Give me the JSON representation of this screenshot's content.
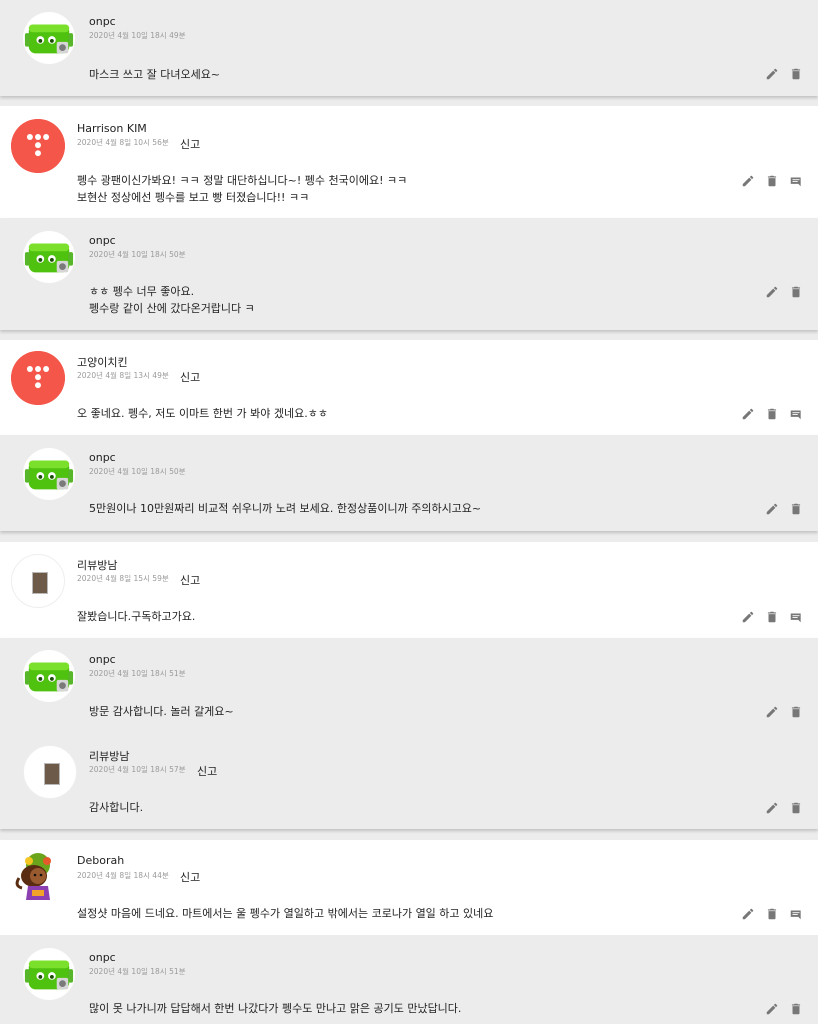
{
  "colors": {
    "accent_red": "#f4574a",
    "onpc_green": "#55c411",
    "reply_bg": "#ececec",
    "comment_bg": "#ffffff",
    "icon": "#777777"
  },
  "icons": {
    "edit": "pencil-icon",
    "delete": "trash-icon",
    "reply": "comment-icon"
  },
  "report_label": "신고",
  "threads": [
    {
      "replies": [
        {
          "author": "onpc",
          "date": "2020년 4월 10일 18시 49분",
          "lines": [
            "마스크 쓰고 잘 다녀오세요~"
          ]
        }
      ]
    },
    {
      "comment": {
        "author": "Harrison KIM",
        "date": "2020년 4월 8일 10시 56분",
        "lines": [
          "펭수 광팬이신가봐요! ㅋㅋ 정말 대단하십니다~! 펭수 천국이에요! ㅋㅋ",
          "보현산 정상에선 펭수를 보고 빵 터졌습니다!! ㅋㅋ"
        ]
      },
      "replies": [
        {
          "author": "onpc",
          "date": "2020년 4월 10일 18시 50분",
          "lines": [
            "ㅎㅎ 펭수 너무 좋아요.",
            "펭수랑 같이 산에 갔다온거랍니다 ㅋ"
          ]
        }
      ]
    },
    {
      "comment": {
        "author": "고양이치킨",
        "date": "2020년 4월 8일 13시 49분",
        "lines": [
          "오 좋네요. 펭수, 저도 이마트 한번 가 봐야 겠네요.ㅎㅎ"
        ]
      },
      "replies": [
        {
          "author": "onpc",
          "date": "2020년 4월 10일 18시 50분",
          "lines": [
            "5만원이나 10만원짜리 비교적 쉬우니까 노려 보세요. 한정상품이니까 주의하시고요~"
          ]
        }
      ]
    },
    {
      "comment": {
        "author": "리뷰방남",
        "date": "2020년 4월 8일 15시 59분",
        "lines": [
          "잘봤습니다.구독하고가요."
        ]
      },
      "replies": [
        {
          "author": "onpc",
          "date": "2020년 4월 10일 18시 51분",
          "lines": [
            "방문 감사합니다. 놀러 갈게요~"
          ]
        },
        {
          "author": "리뷰방남",
          "date": "2020년 4월 10일 18시 57분",
          "lines": [
            "감사합니다."
          ]
        }
      ]
    },
    {
      "comment": {
        "author": "Deborah",
        "date": "2020년 4월 8일 18시 44분",
        "lines": [
          "설정샷 마음에 드네요. 마트에서는 울 펭수가 열일하고 밖에서는 코로나가 열일 하고 있네요"
        ]
      },
      "replies": [
        {
          "author": "onpc",
          "date": "2020년 4월 10일 18시 51분",
          "lines": [
            "많이 못 나가니까 답답해서 한번 나갔다가 펭수도 만나고 맑은 공기도 만났답니다."
          ]
        }
      ]
    }
  ]
}
